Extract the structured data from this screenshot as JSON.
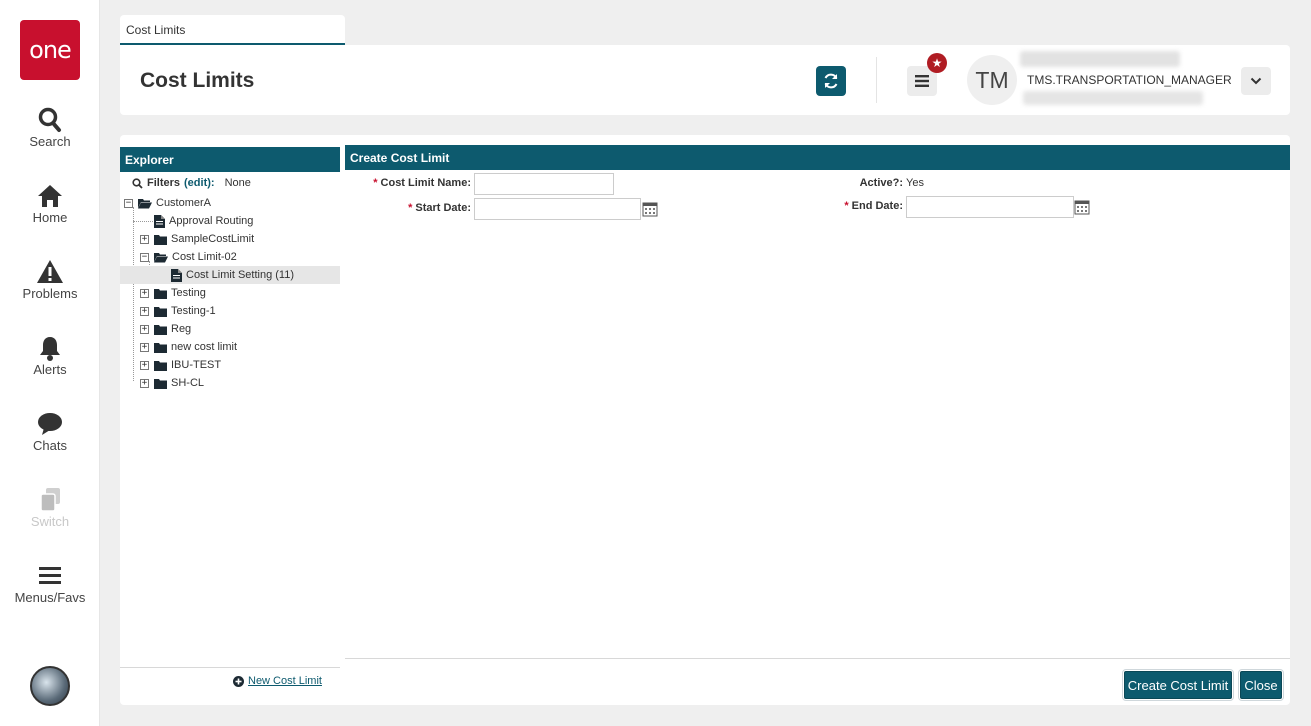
{
  "app": {
    "logo_text": "one",
    "brand_color": "#c8102e",
    "accent_color": "#0d5a6e"
  },
  "nav": {
    "items": [
      {
        "label": "Search",
        "icon": "search-icon"
      },
      {
        "label": "Home",
        "icon": "home-icon"
      },
      {
        "label": "Problems",
        "icon": "warning-icon"
      },
      {
        "label": "Alerts",
        "icon": "bell-icon"
      },
      {
        "label": "Chats",
        "icon": "chat-icon"
      },
      {
        "label": "Switch",
        "icon": "switch-icon",
        "disabled": true
      },
      {
        "label": "Menus/Favs",
        "icon": "hamburger-icon"
      }
    ]
  },
  "tab": {
    "label": "Cost Limits"
  },
  "header": {
    "title": "Cost Limits",
    "user_initials": "TM",
    "user_role": "TMS.TRANSPORTATION_MANAGER"
  },
  "explorer": {
    "title": "Explorer",
    "filters_label": "Filters",
    "filters_edit": "(edit):",
    "filters_value": "None",
    "tree": [
      {
        "label": "CustomerA",
        "type": "folder-open",
        "toggle": "−"
      },
      {
        "label": "Approval Routing",
        "type": "doc"
      },
      {
        "label": "SampleCostLimit",
        "type": "folder",
        "toggle": "+"
      },
      {
        "label": "Cost Limit-02",
        "type": "folder-open",
        "toggle": "−"
      },
      {
        "label": "Cost Limit Setting (11)",
        "type": "doc",
        "selected": true
      },
      {
        "label": "Testing",
        "type": "folder",
        "toggle": "+"
      },
      {
        "label": "Testing-1",
        "type": "folder",
        "toggle": "+"
      },
      {
        "label": "Reg",
        "type": "folder",
        "toggle": "+"
      },
      {
        "label": "new cost limit",
        "type": "folder",
        "toggle": "+"
      },
      {
        "label": "IBU-TEST",
        "type": "folder",
        "toggle": "+"
      },
      {
        "label": "SH-CL",
        "type": "folder",
        "toggle": "+"
      }
    ],
    "new_link": "New Cost Limit"
  },
  "form": {
    "title": "Create Cost Limit",
    "required_marker": "*",
    "cost_limit_name_label": "Cost Limit Name:",
    "cost_limit_name_value": "",
    "start_date_label": "Start Date:",
    "start_date_value": "",
    "active_label": "Active?:",
    "active_value": "Yes",
    "end_date_label": "End Date:",
    "end_date_value": ""
  },
  "buttons": {
    "create": "Create Cost Limit",
    "close": "Close"
  }
}
